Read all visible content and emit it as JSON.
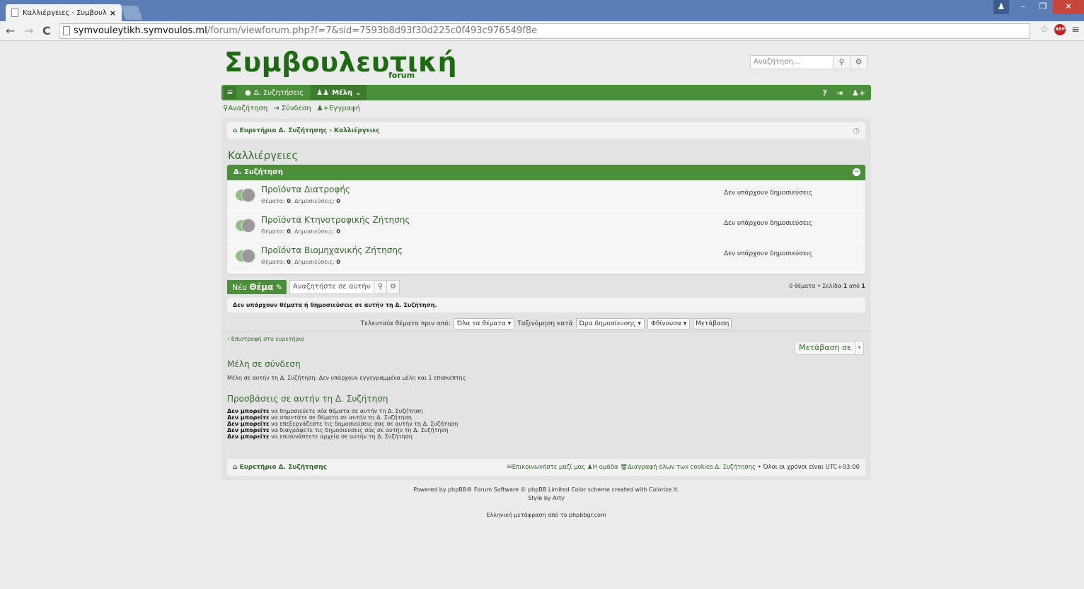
{
  "browser": {
    "tab_title": "Καλλιέργειες - Συμβουλευ",
    "url_host": "symvouleytikh.symvoulos.ml",
    "url_path": "/forum/viewforum.php?f=7&sid=7593b8d93f30d225c0f493c976549f8e",
    "abp_label": "ABP"
  },
  "header": {
    "logo": "Συμβουλευτική",
    "logo_sub": "forum",
    "search_placeholder": "Αναζήτηση…"
  },
  "navbar": {
    "discussions": "Δ. Συζητήσεις",
    "members": "Μέλη"
  },
  "quicklinks": {
    "search": "Αναζήτηση",
    "login": "Σύνδεση",
    "register": "Εγγραφή"
  },
  "breadcrumb": {
    "index": "Ευρετήριο Δ. Συζήτησης",
    "sep": "›",
    "current": "Καλλιέργειες"
  },
  "page_title": "Καλλιέργειες",
  "forum_header": "Δ. Συζήτηση",
  "forums": [
    {
      "name": "Προϊόντα Διατροφής",
      "topics_label": "Θέματα:",
      "topics": "0",
      "posts_label": "Δημοσιεύσεις:",
      "posts": "0",
      "last_post": "Δεν υπάρχουν δημοσιεύσεις"
    },
    {
      "name": "Προϊόντα Κτηνοτροφικής Ζήτησης",
      "topics_label": "Θέματα:",
      "topics": "0",
      "posts_label": "Δημοσιεύσεις:",
      "posts": "0",
      "last_post": "Δεν υπάρχουν δημοσιεύσεις"
    },
    {
      "name": "Προϊόντα Βιομηχανικής Ζήτησης",
      "topics_label": "Θέματα:",
      "topics": "0",
      "posts_label": "Δημοσιεύσεις:",
      "posts": "0",
      "last_post": "Δεν υπάρχουν δημοσιεύσεις"
    }
  ],
  "actions": {
    "new_prefix": "Νέο",
    "new_bold": "Θέμα",
    "forum_search_placeholder": "Αναζητήστε σε αυτήν",
    "pager_pre": "0 θέματα • Σελίδα",
    "pager_page": "1",
    "pager_mid": "από",
    "pager_total": "1"
  },
  "notice": "Δεν υπάρχουν θέματα ή δημοσιεύσεις σε αυτήν τη Δ. Συζήτηση.",
  "sort": {
    "last_topics_label": "Τελευταία θέματα πριν από:",
    "days_value": "Όλα τα θέματα",
    "sort_by_label": "Ταξινόμηση κατά",
    "sort_key_value": "Ώρα δημοσίευσης",
    "direction_value": "Φθίνουσα",
    "go": "Μετάβαση"
  },
  "back_link": "Επιστροφή στο ευρετήριο",
  "jump_to": "Μετάβαση σε",
  "online": {
    "heading": "Μέλη σε σύνδεση",
    "text": "Μέλη σε αυτήν τη Δ. Συζήτηση: Δεν υπάρχουν εγγεγραμμένα μέλη και 1 επισκέπτης"
  },
  "permissions": {
    "heading": "Προσβάσεις σε αυτήν τη Δ. Συζήτηση",
    "items": [
      {
        "bold": "Δεν μπορείτε",
        "rest": "να δημοσιεύετε νέα θέματα σε αυτήν τη Δ. Συζήτηση"
      },
      {
        "bold": "Δεν μπορείτε",
        "rest": "να απαντάτε σε θέματα σε αυτήν τη Δ. Συζήτηση"
      },
      {
        "bold": "Δεν μπορείτε",
        "rest": "να επεξεργάζεστε τις δημοσιεύσεις σας σε αυτήν τη Δ. Συζήτηση"
      },
      {
        "bold": "Δεν μπορείτε",
        "rest": "να διαγράφετε τις δημοσιεύσεις σας σε αυτήν τη Δ. Συζήτηση"
      },
      {
        "bold": "Δεν μπορείτε",
        "rest": "να επισυνάπτετε αρχεία σε αυτήν τη Δ. Συζήτηση"
      }
    ]
  },
  "footer_nav": {
    "index": "Ευρετήριο Δ. Συζήτησης",
    "contact": "Επικοινωνήστε μαζί μας",
    "team": "Η ομάδα",
    "cookies": "Διαγραφή όλων των cookies Δ. Συζήτησης",
    "timezone": "• Όλοι οι χρόνοι είναι UTC+03:00"
  },
  "copyright": {
    "line1": "Powered by phpBB® Forum Software © phpBB Limited Color scheme created with Colorize It.",
    "line2": "Style by Arty",
    "line3": "Ελληνική μετάφραση από το phpbbgr.com"
  },
  "colors": {
    "accent": "#4c8f3a",
    "logo": "#1e6a12",
    "link": "#356a2d"
  }
}
